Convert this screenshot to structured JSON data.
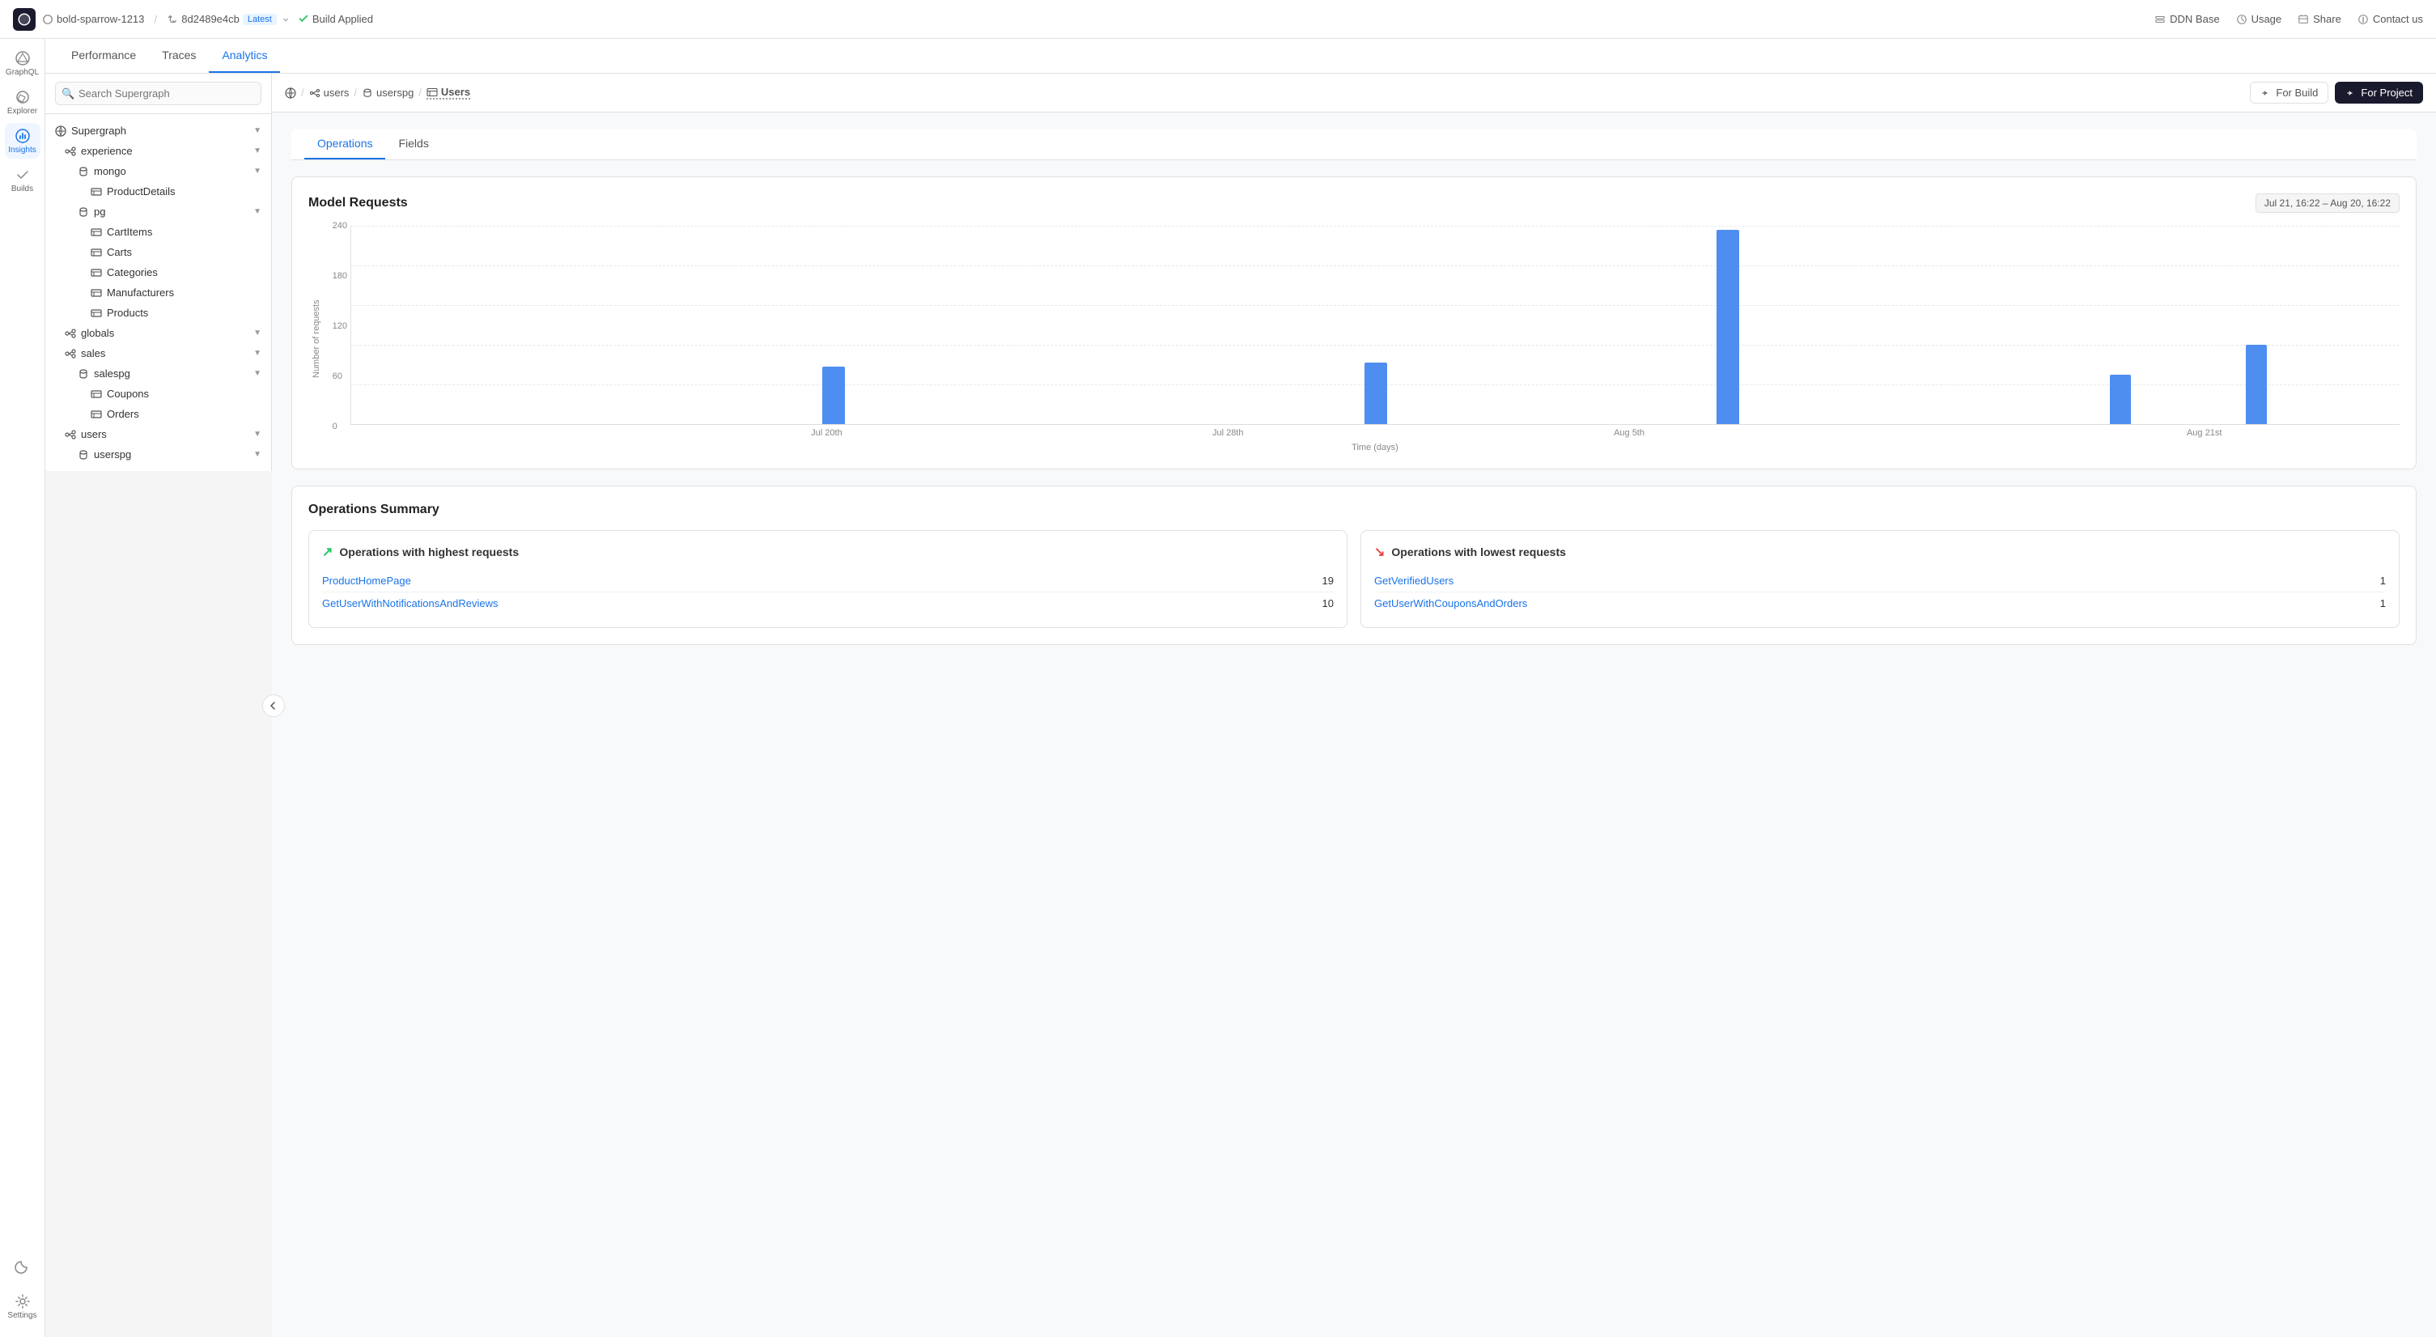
{
  "topbar": {
    "logo_alt": "Apollo",
    "project": "bold-sparrow-1213",
    "sep1": "/",
    "branch_icon": "branch-icon",
    "branch": "8d2489e4cb",
    "badge": "Latest",
    "build_status": "Build Applied",
    "right_items": [
      {
        "icon": "database-icon",
        "label": "DDN Base"
      },
      {
        "icon": "usage-icon",
        "label": "Usage"
      },
      {
        "icon": "share-icon",
        "label": "Share"
      },
      {
        "icon": "contact-icon",
        "label": "Contact us"
      }
    ]
  },
  "nav_tabs": [
    {
      "label": "Performance",
      "active": false
    },
    {
      "label": "Traces",
      "active": false
    },
    {
      "label": "Analytics",
      "active": true
    }
  ],
  "sidebar": {
    "search_placeholder": "Search Supergraph",
    "tree": [
      {
        "label": "Supergraph",
        "level": 0,
        "icon": "globe-icon",
        "chevron": true,
        "expanded": true
      },
      {
        "label": "experience",
        "level": 1,
        "icon": "subgraph-icon",
        "chevron": true,
        "expanded": true
      },
      {
        "label": "mongo",
        "level": 2,
        "icon": "db-icon",
        "chevron": true,
        "expanded": true
      },
      {
        "label": "ProductDetails",
        "level": 3,
        "icon": "table-icon"
      },
      {
        "label": "pg",
        "level": 2,
        "icon": "db-icon",
        "chevron": true,
        "expanded": true
      },
      {
        "label": "CartItems",
        "level": 3,
        "icon": "table-icon"
      },
      {
        "label": "Carts",
        "level": 3,
        "icon": "table-icon"
      },
      {
        "label": "Categories",
        "level": 3,
        "icon": "table-icon"
      },
      {
        "label": "Manufacturers",
        "level": 3,
        "icon": "table-icon"
      },
      {
        "label": "Products",
        "level": 3,
        "icon": "table-icon"
      },
      {
        "label": "globals",
        "level": 1,
        "icon": "subgraph-icon",
        "chevron": true
      },
      {
        "label": "sales",
        "level": 1,
        "icon": "subgraph-icon",
        "chevron": true,
        "expanded": true
      },
      {
        "label": "salespg",
        "level": 2,
        "icon": "db-icon",
        "chevron": true,
        "expanded": true
      },
      {
        "label": "Coupons",
        "level": 3,
        "icon": "table-icon"
      },
      {
        "label": "Orders",
        "level": 3,
        "icon": "table-icon"
      },
      {
        "label": "users",
        "level": 1,
        "icon": "subgraph-icon",
        "chevron": true
      },
      {
        "label": "userspg",
        "level": 2,
        "icon": "db-icon",
        "chevron": true
      }
    ]
  },
  "breadcrumb": {
    "items": [
      {
        "icon": "globe-icon",
        "label": ""
      },
      {
        "icon": "subgraph-icon",
        "label": "users"
      },
      {
        "icon": "db-icon",
        "label": "userspg"
      },
      {
        "icon": "table-icon",
        "label": "Users",
        "last": true
      }
    ],
    "for_build_label": "For Build",
    "for_project_label": "For Project"
  },
  "sub_tabs": [
    {
      "label": "Operations",
      "active": true
    },
    {
      "label": "Fields",
      "active": false
    }
  ],
  "chart": {
    "title": "Model Requests",
    "date_range": "Jul 21, 16:22 – Aug 20, 16:22",
    "y_label": "Number of requests",
    "x_label": "Time (days)",
    "y_ticks": [
      "240",
      "180",
      "120",
      "60",
      "0"
    ],
    "x_ticks": [
      "Jul 20th",
      "Jul 28th",
      "Aug 5th",
      "Aug 21st"
    ],
    "bars": [
      {
        "value": 0,
        "label": "Jul 20th"
      },
      {
        "value": 0,
        "label": ""
      },
      {
        "value": 75,
        "label": "Jul 28th"
      },
      {
        "value": 0,
        "label": ""
      },
      {
        "value": 80,
        "label": "Aug 5th"
      },
      {
        "value": 255,
        "label": ""
      },
      {
        "value": 65,
        "label": "Aug 21st"
      },
      {
        "value": 105,
        "label": ""
      }
    ],
    "max_value": 260
  },
  "ops_summary": {
    "title": "Operations Summary",
    "highest": {
      "title": "Operations with highest requests",
      "icon": "trend-up-icon",
      "rows": [
        {
          "label": "ProductHomePage",
          "count": 19
        },
        {
          "label": "GetUserWithNotificationsAndReviews",
          "count": 10
        }
      ]
    },
    "lowest": {
      "title": "Operations with lowest requests",
      "icon": "trend-down-icon",
      "rows": [
        {
          "label": "GetVerifiedUsers",
          "count": 1
        },
        {
          "label": "GetUserWithCouponsAndOrders",
          "count": 1
        }
      ]
    }
  },
  "icon_bar": {
    "items": [
      {
        "label": "GraphQL",
        "icon": "graphql-icon",
        "active": false
      },
      {
        "label": "Explorer",
        "icon": "explorer-icon",
        "active": false
      },
      {
        "label": "Insights",
        "icon": "insights-icon",
        "active": true
      },
      {
        "label": "Builds",
        "icon": "builds-icon",
        "active": false
      }
    ],
    "bottom_items": [
      {
        "label": "",
        "icon": "moon-icon"
      },
      {
        "label": "Settings",
        "icon": "settings-icon"
      }
    ]
  }
}
